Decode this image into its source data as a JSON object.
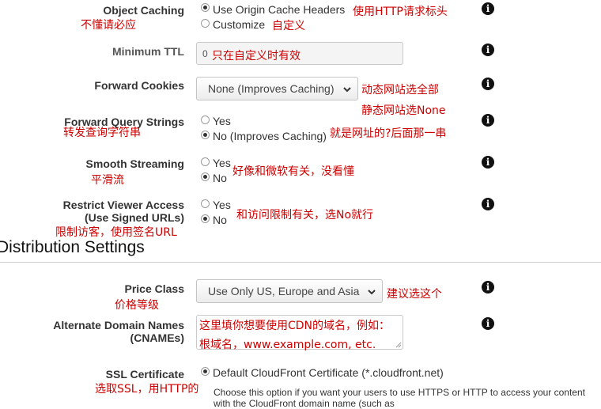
{
  "object_caching": {
    "label": "Object Caching",
    "note": "不懂请必应",
    "option1": "Use Origin Cache Headers",
    "option1_note": "使用HTTP请求标头",
    "option2": "Customize",
    "option2_note": "自定义"
  },
  "minimum_ttl": {
    "label": "Minimum TTL",
    "value": "0",
    "note": "只在自定义时有效"
  },
  "forward_cookies": {
    "label": "Forward Cookies",
    "value": "None (Improves Caching)",
    "note1": "动态网站选全部",
    "note2": "静态网站选None"
  },
  "forward_query": {
    "label": "Forward Query Strings",
    "note": "转发查询字符串",
    "yes": "Yes",
    "no": "No (Improves Caching)",
    "no_note": "就是网址的?后面那一串"
  },
  "smooth_streaming": {
    "label": "Smooth Streaming",
    "note": "平滑流",
    "yes": "Yes",
    "yes_note": "好像和微软有关，没看懂",
    "no": "No"
  },
  "restrict_viewer": {
    "label1": "Restrict Viewer Access",
    "label2": "(Use Signed URLs)",
    "note": "限制访客，使用签名URL",
    "yes": "Yes",
    "yes_note": "和访问限制有关，选No就行",
    "no": "No"
  },
  "section_title": "Distribution Settings",
  "price_class": {
    "label": "Price Class",
    "note": "价格等级",
    "value": "Use Only US, Europe and Asia",
    "value_note": "建议选这个"
  },
  "alternate_domain": {
    "label1": "Alternate Domain Names",
    "label2": "(CNAMEs)",
    "line1": "这里填你想要使用CDN的域名，例如：",
    "line2": "根域名，www.example.com, etc."
  },
  "ssl_certificate": {
    "label": "SSL Certificate",
    "note": "选取SSL，用HTTP的",
    "option1": "Default CloudFront Certificate (*.cloudfront.net)",
    "help1": "Choose this option if you want your users to use HTTPS or HTTP to access your content",
    "help2": "with the CloudFront domain name (such as"
  },
  "icons": {
    "info": "info-icon",
    "chevron": "chevron-down-icon"
  },
  "colors": {
    "annotation": "#cc0000",
    "info_icon": "#111111"
  }
}
